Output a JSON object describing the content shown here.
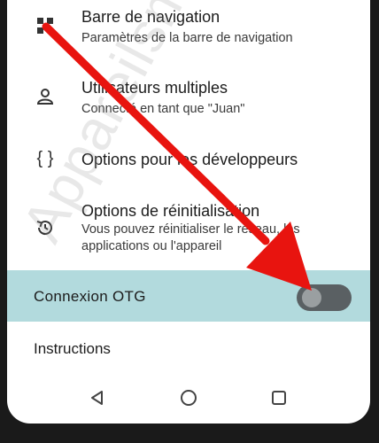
{
  "settings": {
    "items": [
      {
        "title": "Barre de navigation",
        "subtitle": "Paramètres de la barre de navigation",
        "icon": "nav-bar-icon"
      },
      {
        "title": "Utilisateurs multiples",
        "subtitle": "Connecté en tant que \"Juan\"",
        "icon": "person-icon"
      },
      {
        "title": "Options pour les développeurs",
        "subtitle": "",
        "icon": "braces-icon"
      },
      {
        "title": "Options de réinitialisation",
        "subtitle": "Vous pouvez réinitialiser le réseau, les applications ou l'appareil",
        "icon": "history-icon"
      }
    ],
    "otg": {
      "label": "Connexion OTG",
      "enabled": false,
      "highlight_color": "#b2dadd"
    },
    "instructions": {
      "label": "Instructions"
    }
  },
  "navbar": {
    "back_icon": "back-icon",
    "home_icon": "home-icon",
    "recents_icon": "recents-icon"
  },
  "annotation": {
    "arrow_color": "#e8140f"
  },
  "watermark": {
    "text": "Appareilsmobiles.fr"
  }
}
